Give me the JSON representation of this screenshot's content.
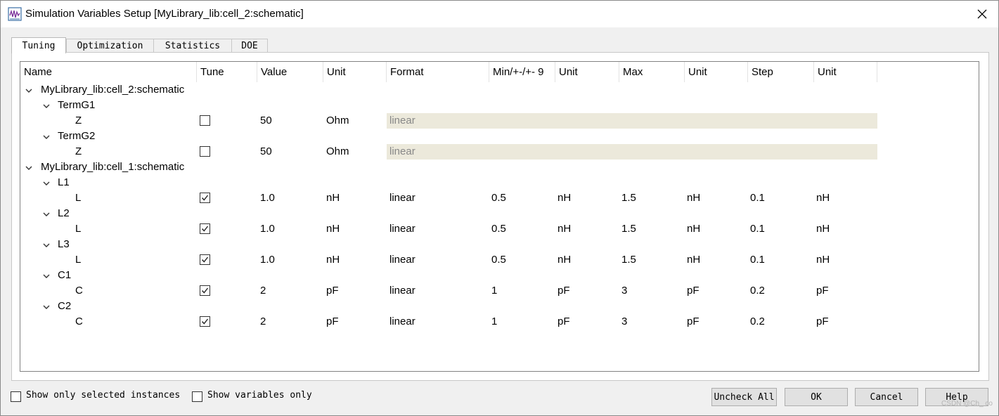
{
  "window": {
    "title": "Simulation Variables Setup [MyLibrary_lib:cell_2:schematic]"
  },
  "tabs": [
    {
      "label": "Tuning",
      "active": true
    },
    {
      "label": "Optimization",
      "active": false
    },
    {
      "label": "Statistics",
      "active": false
    },
    {
      "label": "DOE",
      "active": false
    }
  ],
  "columns": [
    "Name",
    "Tune",
    "Value",
    "Unit",
    "Format",
    "Min/+-/+- 9",
    "Unit",
    "Max",
    "Unit",
    "Step",
    "Unit"
  ],
  "rows": [
    {
      "kind": "cell",
      "name": "MyLibrary_lib:cell_2:schematic"
    },
    {
      "kind": "instance",
      "name": "TermG1"
    },
    {
      "kind": "var",
      "name": "Z",
      "tune": false,
      "value": "50",
      "unit": "Ohm",
      "format": "linear",
      "disabled": true
    },
    {
      "kind": "instance",
      "name": "TermG2"
    },
    {
      "kind": "var",
      "name": "Z",
      "tune": false,
      "value": "50",
      "unit": "Ohm",
      "format": "linear",
      "disabled": true
    },
    {
      "kind": "cell",
      "name": "MyLibrary_lib:cell_1:schematic"
    },
    {
      "kind": "instance",
      "name": "L1"
    },
    {
      "kind": "var",
      "name": "L",
      "tune": true,
      "value": "1.0",
      "unit": "nH",
      "format": "linear",
      "min": "0.5",
      "min_unit": "nH",
      "max": "1.5",
      "max_unit": "nH",
      "step": "0.1",
      "step_unit": "nH"
    },
    {
      "kind": "instance",
      "name": "L2"
    },
    {
      "kind": "var",
      "name": "L",
      "tune": true,
      "value": "1.0",
      "unit": "nH",
      "format": "linear",
      "min": "0.5",
      "min_unit": "nH",
      "max": "1.5",
      "max_unit": "nH",
      "step": "0.1",
      "step_unit": "nH"
    },
    {
      "kind": "instance",
      "name": "L3"
    },
    {
      "kind": "var",
      "name": "L",
      "tune": true,
      "value": "1.0",
      "unit": "nH",
      "format": "linear",
      "min": "0.5",
      "min_unit": "nH",
      "max": "1.5",
      "max_unit": "nH",
      "step": "0.1",
      "step_unit": "nH"
    },
    {
      "kind": "instance",
      "name": "C1"
    },
    {
      "kind": "var",
      "name": "C",
      "tune": true,
      "value": "2",
      "unit": "pF",
      "format": "linear",
      "min": "1",
      "min_unit": "pF",
      "max": "3",
      "max_unit": "pF",
      "step": "0.2",
      "step_unit": "pF"
    },
    {
      "kind": "instance",
      "name": "C2"
    },
    {
      "kind": "var",
      "name": "C",
      "tune": true,
      "value": "2",
      "unit": "pF",
      "format": "linear",
      "min": "1",
      "min_unit": "pF",
      "max": "3",
      "max_unit": "pF",
      "step": "0.2",
      "step_unit": "pF"
    }
  ],
  "options": {
    "show_selected_label": "Show only selected instances",
    "show_selected_checked": false,
    "show_vars_label": "Show variables only",
    "show_vars_checked": false
  },
  "buttons": {
    "uncheck_all": "Uncheck All",
    "ok": "OK",
    "cancel": "Cancel",
    "help": "Help"
  },
  "watermark": "CSDN @Ch_ co"
}
